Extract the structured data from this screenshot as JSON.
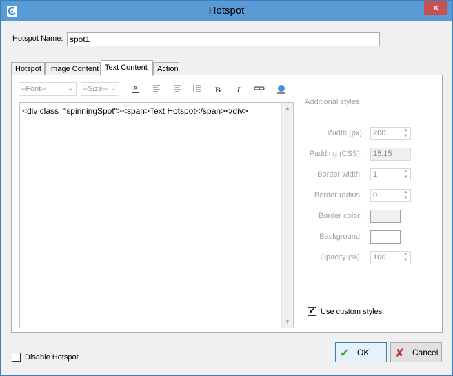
{
  "window": {
    "title": "Hotspot",
    "close_glyph": "✕"
  },
  "hotspot_name": {
    "label": "Hotspot Name:",
    "value": "spot1"
  },
  "tabs": [
    {
      "label": "Hotspot"
    },
    {
      "label": "Image Content"
    },
    {
      "label": "Text Content"
    },
    {
      "label": "Action"
    }
  ],
  "toolbar": {
    "font_select": "--Font--",
    "size_select": "--Size--",
    "icons": [
      "font-color-icon",
      "align-left-icon",
      "align-center-icon",
      "list-icon",
      "bold-icon",
      "italic-icon",
      "link-icon",
      "image-icon"
    ]
  },
  "editor": {
    "content": "<div class=\"spinningSpot\"><span>Text Hotspot</span></div>"
  },
  "additional_styles": {
    "title": "Additional styles",
    "width": {
      "label": "Width (px)",
      "value": "200"
    },
    "padding": {
      "label": "Padding (CSS):",
      "value": "15,15"
    },
    "border_width": {
      "label": "Border width:",
      "value": "1"
    },
    "border_radius": {
      "label": "Border radius:",
      "value": "0"
    },
    "border_color": {
      "label": "Border color:",
      "color": "#f0f0f0"
    },
    "background": {
      "label": "Background:",
      "color": "#ffffff"
    },
    "opacity": {
      "label": "Opacity (%):",
      "value": "100"
    }
  },
  "use_custom_styles": {
    "label": "Use custom styles",
    "checked": true
  },
  "disable_hotspot": {
    "label": "Disable Hotspot",
    "checked": false
  },
  "buttons": {
    "ok": "OK",
    "cancel": "Cancel"
  },
  "colors": {
    "titlebar": "#5b9bd5",
    "close": "#c75050",
    "ok_check": "#3aa53a",
    "cancel_x": "#c0392b"
  }
}
